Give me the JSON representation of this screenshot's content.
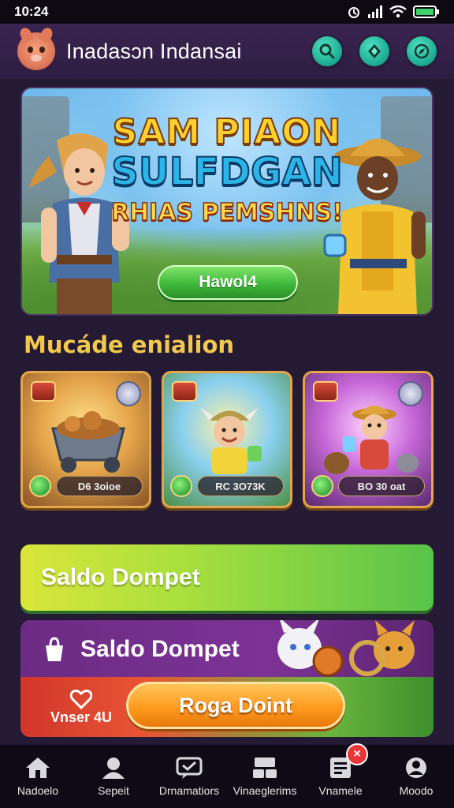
{
  "status_bar": {
    "time": "10:24"
  },
  "header": {
    "title": "Inadasɔn  Indansai",
    "actions": [
      {
        "icon": "search-icon"
      },
      {
        "icon": "diamond-icon"
      },
      {
        "icon": "compass-icon"
      }
    ]
  },
  "banner": {
    "headline_1": "SAM PIAON",
    "headline_2": "SULFDGAN",
    "headline_3": "RHIAS PEMSHNS!",
    "cta_label": "Hawol4"
  },
  "section": {
    "title": "Mucáde enialion"
  },
  "cards": [
    {
      "label": "D6 3oioe"
    },
    {
      "label": "RC 3O73K"
    },
    {
      "label": "BO 30 oat"
    }
  ],
  "wallet": {
    "label": "Saldo Dompet"
  },
  "promo": {
    "title": "Saldo Dompet",
    "voucher_label": "Vnser 4U",
    "cta_label": "Roga Doint"
  },
  "bottom_nav": [
    {
      "label": "Nadoelo",
      "icon": "home-icon"
    },
    {
      "label": "Sepeit",
      "icon": "user-icon"
    },
    {
      "label": "Drnamatiors",
      "icon": "chat-icon"
    },
    {
      "label": "Vinaeglerims",
      "icon": "gallery-icon"
    },
    {
      "label": "Vnamele",
      "icon": "document-icon",
      "badge": "×"
    },
    {
      "label": "Moodo",
      "icon": "profile-icon"
    }
  ],
  "colors": {
    "background": "#241a33",
    "accent_teal": "#1aa88e",
    "section_title": "#f2c94c",
    "cta_green": "#3fb83a",
    "cta_orange": "#ff9a1f",
    "badge_red": "#e8363a"
  }
}
